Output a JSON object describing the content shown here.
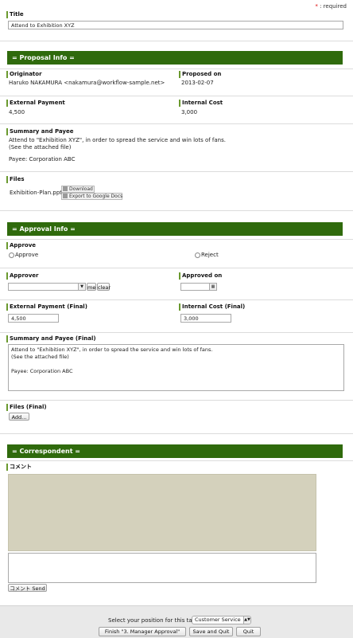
{
  "required_note": {
    "star": "*",
    "text": ": required"
  },
  "title_section": {
    "label": "Title",
    "value": "Attend to Exhibition XYZ"
  },
  "proposal": {
    "header": "= Proposal Info =",
    "originator_label": "Originator",
    "originator_value": "Haruko NAKAMURA <nakamura@workflow-sample.net>",
    "proposed_on_label": "Proposed on",
    "proposed_on_value": "2013-02-07",
    "external_payment_label": "External Payment",
    "external_payment_value": "4,500",
    "internal_cost_label": "Internal Cost",
    "internal_cost_value": "3,000",
    "summary_label": "Summary and Payee",
    "summary_lines": [
      "Attend to \"Exhibition XYZ\", in order to spread the service and win lots of fans.",
      "(See the attached file)",
      "",
      "Payee: Corporation ABC"
    ],
    "files_label": "Files",
    "file_name": "Exhibition-Plan.pptx",
    "download_label": "Download",
    "export_label": "Export to Google Docs"
  },
  "approval": {
    "header": "= Approval Info =",
    "approve_label": "Approve",
    "approve_option": "Approve",
    "reject_option": "Reject",
    "approver_label": "Approver",
    "me_button": "me",
    "clear_button": "clear",
    "approved_on_label": "Approved on",
    "ext_final_label": "External Payment (Final)",
    "ext_final_value": "4,500",
    "int_final_label": "Internal Cost (Final)",
    "int_final_value": "3,000",
    "summary_final_label": "Summary and Payee (Final)",
    "summary_final_lines": [
      "Attend to \"Exhibition XYZ\", in order to spread the service and win lots of fans.",
      "(See the attached file)",
      "",
      "Payee: Corporation ABC"
    ],
    "files_final_label": "Files (Final)",
    "add_button": "Add..."
  },
  "correspondent": {
    "header": "= Correspondent =",
    "comment_label": "コメント",
    "comment_send_button": "コメント Send"
  },
  "footer": {
    "position_prompt": "Select your position for this task*",
    "position_selected": "Customer Service",
    "finish_button": "Finish \"3. Manager Approval\"",
    "save_quit_button": "Save and Quit",
    "quit_button": "Quit"
  }
}
